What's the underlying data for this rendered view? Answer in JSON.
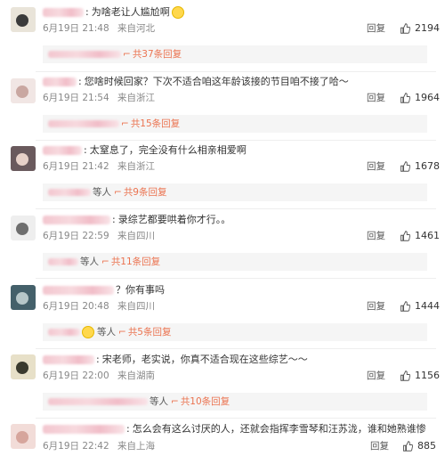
{
  "comments": [
    {
      "text": "为啥老让人尴尬啊",
      "date": "6月19日 21:48",
      "location": "来自河北",
      "reply_label": "回复",
      "likes": "2194",
      "reply_summary": {
        "prefix": "",
        "count": "共37条回复"
      },
      "has_emoji": true
    },
    {
      "text": "您啥时候回家？下次不适合咱这年龄该接的节目咱不接了哈～",
      "date": "6月19日 21:54",
      "location": "来自浙江",
      "reply_label": "回复",
      "likes": "1964",
      "reply_summary": {
        "prefix": "",
        "count": "共15条回复"
      }
    },
    {
      "text": "太窒息了，完全没有什么相亲相爱啊",
      "date": "6月19日 21:42",
      "location": "来自浙江",
      "reply_label": "回复",
      "likes": "1678",
      "reply_summary": {
        "prefix": "等人",
        "count": "共9条回复"
      }
    },
    {
      "text": "录综艺都要哄着你才行。。",
      "date": "6月19日 22:59",
      "location": "来自四川",
      "reply_label": "回复",
      "likes": "1461",
      "reply_summary": {
        "prefix": "等人",
        "count": "共11条回复"
      }
    },
    {
      "text": "？你有事吗",
      "date": "6月19日 20:48",
      "location": "来自四川",
      "reply_label": "回复",
      "likes": "1444",
      "reply_summary": {
        "prefix": "等人",
        "count": "共5条回复"
      }
    },
    {
      "text": "宋老师，老实说，你真不适合现在这些综艺～～",
      "date": "6月19日 22:00",
      "location": "来自湖南",
      "reply_label": "回复",
      "likes": "1156",
      "reply_summary": {
        "prefix": "等人",
        "count": "共10条回复"
      }
    },
    {
      "text": "怎么会有这么讨厌的人，还就会指挥李雪琴和汪苏泷，谁和她熟谁惨",
      "date": "6月19日 22:42",
      "location": "来自上海",
      "reply_label": "回复",
      "likes": "885"
    }
  ],
  "icons": {
    "like": "thumbs-up-icon",
    "reply_count": "comment-bubble-icon"
  },
  "colors": {
    "accent": "#eb7350",
    "meta": "#888888",
    "reply_bg": "#f5f5f5"
  }
}
